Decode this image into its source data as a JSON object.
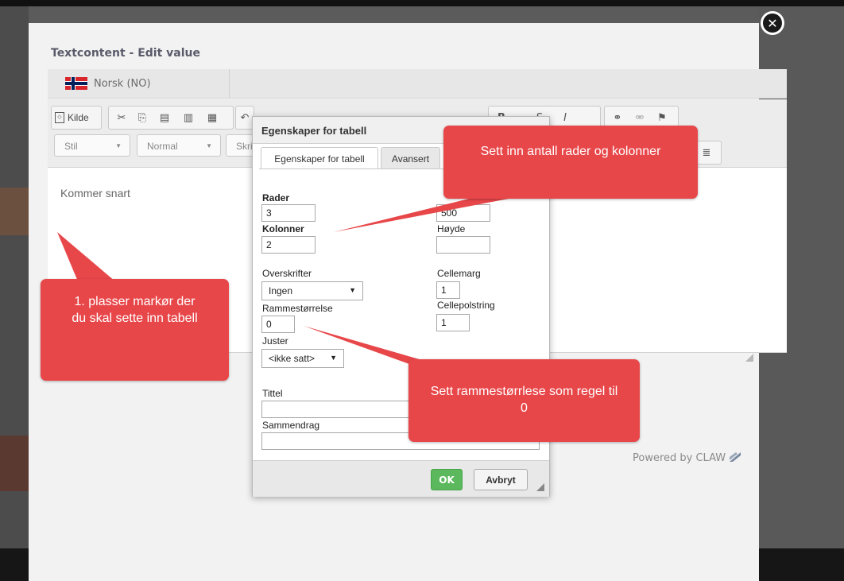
{
  "close": {
    "glyph": "✕"
  },
  "modal": {
    "title": "Textcontent - Edit value",
    "language": {
      "label": "Norsk (NO)",
      "icon": "norway-flag-icon"
    },
    "toolbar": {
      "source_label": "Kilde",
      "style_combo": "Stil",
      "format_combo": "Normal",
      "font_combo": "Skri"
    },
    "editor_text": "Kommer snart",
    "powered_by": "Powered by CLAW"
  },
  "dialog": {
    "title": "Egenskaper for tabell",
    "tabs": [
      "Egenskaper for tabell",
      "Avansert"
    ],
    "fields": {
      "rows_label": "Rader",
      "rows_value": "3",
      "cols_label": "Kolonner",
      "cols_value": "2",
      "width_value": "500",
      "height_label": "Høyde",
      "height_value": "",
      "headers_label": "Overskrifter",
      "headers_value": "Ingen",
      "cellspacing_label": "Cellemarg",
      "cellspacing_value": "1",
      "border_label": "Rammestørrelse",
      "border_value": "0",
      "cellpadding_label": "Cellepolstring",
      "cellpadding_value": "1",
      "align_label": "Juster",
      "align_value": "<ikke satt>",
      "caption_label": "Tittel",
      "caption_value": "",
      "summary_label": "Sammendrag",
      "summary_value": ""
    },
    "ok_label": "OK",
    "cancel_label": "Avbryt"
  },
  "callouts": {
    "rows_cols": "Sett inn antall rader og kolonner",
    "cursor": "1. plasser markør der du skal sette inn tabell",
    "border": "Sett rammestørrlese som regel til 0"
  },
  "colors": {
    "callout": "#e8474a",
    "ok_button": "#5cb85c"
  }
}
